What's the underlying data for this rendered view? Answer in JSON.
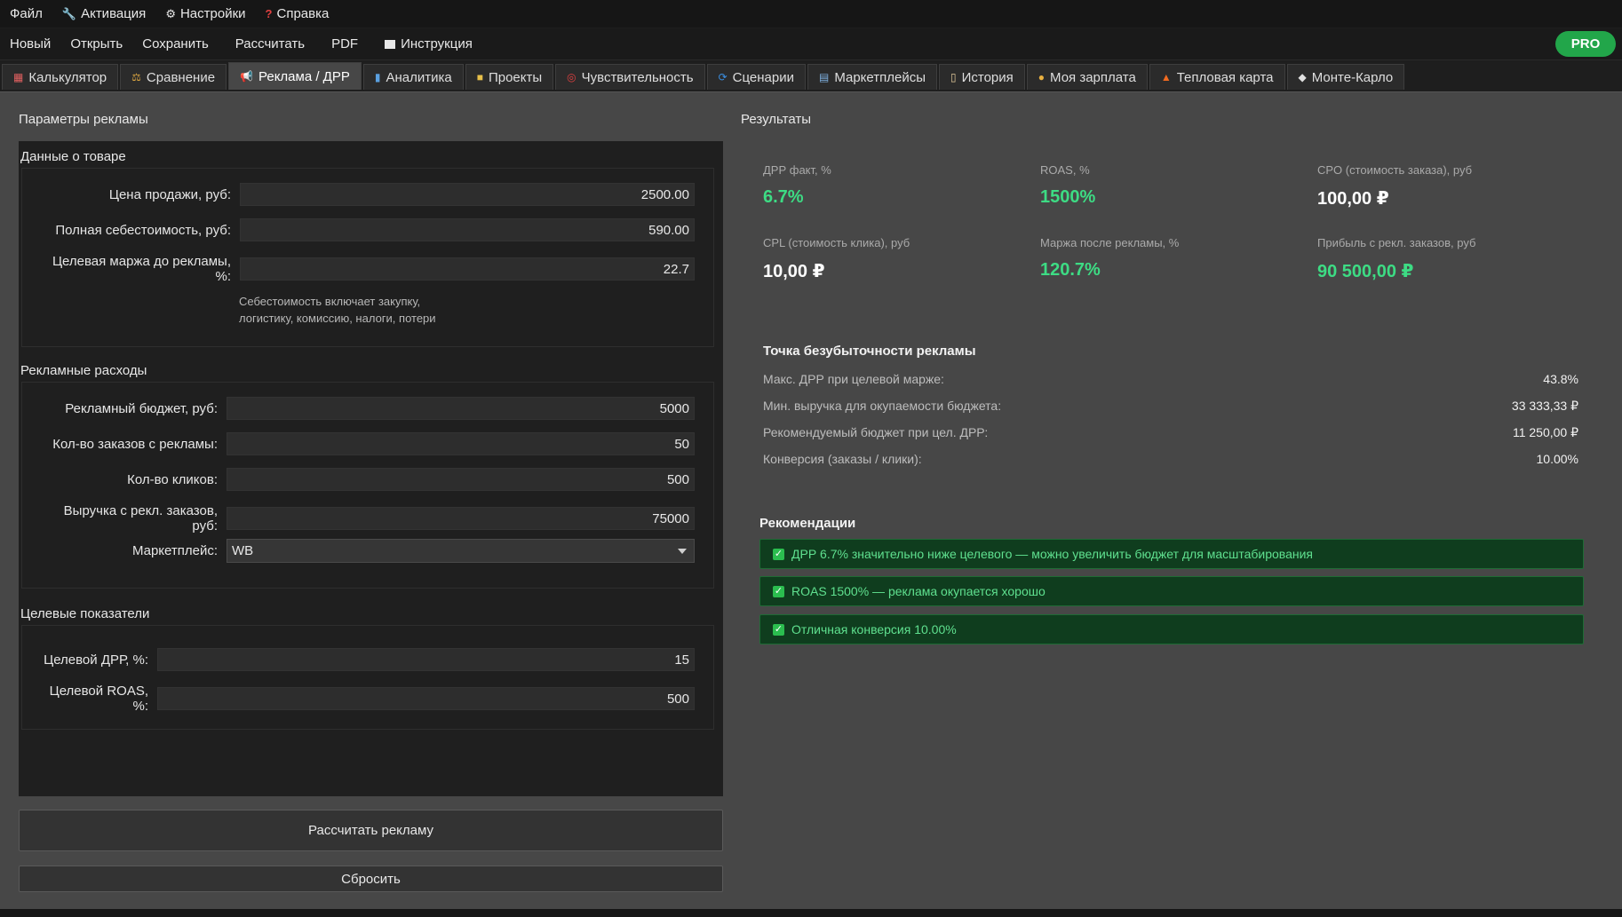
{
  "menu": {
    "file": "Файл",
    "activation": "Активация",
    "settings": "Настройки",
    "help": "Справка"
  },
  "toolbar": {
    "new": "Новый",
    "open": "Открыть",
    "save": "Сохранить",
    "calculate": "Рассчитать",
    "pdf": "PDF",
    "instructions": "Инструкция",
    "pro": "PRO"
  },
  "tabs": [
    {
      "label": "Калькулятор",
      "icon": "calculator-icon"
    },
    {
      "label": "Сравнение",
      "icon": "scales-icon"
    },
    {
      "label": "Реклама / ДРР",
      "icon": "megaphone-icon"
    },
    {
      "label": "Аналитика",
      "icon": "chart-icon"
    },
    {
      "label": "Проекты",
      "icon": "folder-icon"
    },
    {
      "label": "Чувствительность",
      "icon": "target-icon"
    },
    {
      "label": "Сценарии",
      "icon": "cycle-icon"
    },
    {
      "label": "Маркетплейсы",
      "icon": "shop-icon"
    },
    {
      "label": "История",
      "icon": "scroll-icon"
    },
    {
      "label": "Моя зарплата",
      "icon": "money-bag-icon"
    },
    {
      "label": "Тепловая карта",
      "icon": "fire-icon"
    },
    {
      "label": "Монте-Карло",
      "icon": "dice-icon"
    }
  ],
  "params": {
    "title": "Параметры рекламы",
    "product": {
      "title": "Данные о товаре",
      "price_label": "Цена продажи, руб:",
      "price_value": "2500.00",
      "cost_label": "Полная себестоимость, руб:",
      "cost_value": "590.00",
      "margin_label": "Целевая маржа до рекламы, %:",
      "margin_value": "22.7",
      "note_line1": "Себестоимость включает закупку,",
      "note_line2": "логистику, комиссию, налоги, потери"
    },
    "ads": {
      "title": "Рекламные расходы",
      "budget_label": "Рекламный бюджет, руб:",
      "budget_value": "5000",
      "orders_label": "Кол-во заказов с рекламы:",
      "orders_value": "50",
      "clicks_label": "Кол-во кликов:",
      "clicks_value": "500",
      "revenue_label": "Выручка с рекл. заказов, руб:",
      "revenue_value": "75000",
      "marketplace_label": "Маркетплейс:",
      "marketplace_value": "WB"
    },
    "targets": {
      "title": "Целевые показатели",
      "drr_label": "Целевой ДРР, %:",
      "drr_value": "15",
      "roas_label": "Целевой ROAS, %:",
      "roas_value": "500"
    },
    "calc_button": "Рассчитать рекламу",
    "reset_button": "Сбросить"
  },
  "results": {
    "title": "Результаты",
    "metrics": {
      "drr_label": "ДРР факт, %",
      "drr_value": "6.7%",
      "roas_label": "ROAS, %",
      "roas_value": "1500%",
      "cpo_label": "CPO (стоимость заказа), руб",
      "cpo_value": "100,00 ₽",
      "cpl_label": "CPL (стоимость клика), руб",
      "cpl_value": "10,00 ₽",
      "margin_label": "Маржа после рекламы, %",
      "margin_value": "120.7%",
      "profit_label": "Прибыль с рекл. заказов, руб",
      "profit_value": "90 500,00 ₽"
    },
    "breakeven": {
      "title": "Точка безубыточности рекламы",
      "rows": [
        {
          "label": "Макс. ДРР при целевой марже:",
          "value": "43.8%"
        },
        {
          "label": "Мин. выручка для окупаемости бюджета:",
          "value": "33 333,33 ₽"
        },
        {
          "label": "Рекомендуемый бюджет при цел. ДРР:",
          "value": "11 250,00 ₽"
        },
        {
          "label": "Конверсия (заказы / клики):",
          "value": "10.00%"
        }
      ]
    },
    "recommendations": {
      "title": "Рекомендации",
      "items": [
        "ДРР 6.7% значительно ниже целевого — можно увеличить бюджет для масштабирования",
        "ROAS 1500% — реклама окупается хорошо",
        "Отличная конверсия 10.00%"
      ]
    }
  },
  "colors": {
    "accent_green": "#3ddc84",
    "pro_badge": "#22a64a",
    "rec_bg": "#0f3d1e"
  }
}
